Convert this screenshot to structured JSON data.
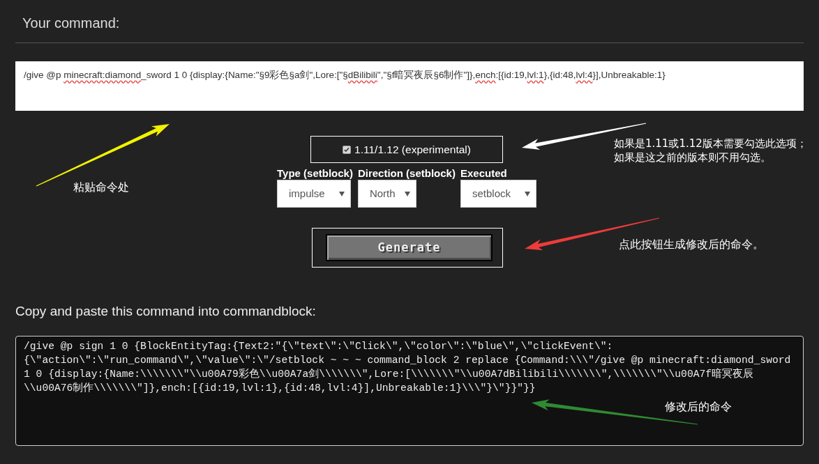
{
  "header": {
    "title": "Your command:"
  },
  "command_input": {
    "value": [
      {
        "text": "/give @p ",
        "flagged": false
      },
      {
        "text": "minecraft:diamond",
        "flagged": true
      },
      {
        "text": "_sword 1 0 {display:{Name:\"§9彩色§a剑\",Lore:[\"§",
        "flagged": false
      },
      {
        "text": "dBilibili",
        "flagged": true
      },
      {
        "text": "\",\"§f暗冥夜辰§6制作\"]},",
        "flagged": false
      },
      {
        "text": "ench",
        "flagged": true
      },
      {
        "text": ":[{id:19,",
        "flagged": false
      },
      {
        "text": "lvl:1",
        "flagged": true
      },
      {
        "text": "},{id:48,",
        "flagged": false
      },
      {
        "text": "lvl:4",
        "flagged": true
      },
      {
        "text": "}],Unbreakable:1}",
        "flagged": false
      }
    ]
  },
  "version_option": {
    "label": "1.11/1.12 (experimental)",
    "checked": true
  },
  "selects": [
    {
      "label": "Type (setblock)",
      "value": "impulse"
    },
    {
      "label": "Direction (setblock)",
      "value": "North"
    },
    {
      "label": "Executed",
      "value": "setblock"
    }
  ],
  "generate_button": {
    "label": "Generate"
  },
  "output": {
    "title": "Copy and paste this command into commandblock:",
    "value": "/give @p sign 1 0 {BlockEntityTag:{Text2:\"{\\\"text\\\":\\\"Click\\\",\\\"color\\\":\\\"blue\\\",\\\"clickEvent\\\":{\\\"action\\\":\\\"run_command\\\",\\\"value\\\":\\\"/setblock ~ ~ ~ command_block 2 replace {Command:\\\\\\\"/give @p minecraft:diamond_sword 1 0 {display:{Name:\\\\\\\\\\\\\\\"\\\\u00A79彩色\\\\u00A7a剑\\\\\\\\\\\\\\\",Lore:[\\\\\\\\\\\\\\\"\\\\u00A7dBilibili\\\\\\\\\\\\\\\",\\\\\\\\\\\\\\\"\\\\u00A7f暗冥夜辰\\\\u00A76制作\\\\\\\\\\\\\\\"]},ench:[{id:19,lvl:1},{id:48,lvl:4}],Unbreakable:1}\\\\\\\"}\\\"}}\"}}"
  },
  "annotations": [
    {
      "lines": [
        "粘贴命令处"
      ],
      "color": "#f2f200"
    },
    {
      "lines": [
        "如果是1.11或1.12版本需要勾选此选项；",
        "如果是这之前的版本则不用勾选。"
      ],
      "color": "#ffffff"
    },
    {
      "lines": [
        "点此按钮生成修改后的命令。"
      ],
      "color": "#ee3b3b"
    },
    {
      "lines": [
        "修改后的命令"
      ],
      "color": "#2f8a32"
    }
  ]
}
